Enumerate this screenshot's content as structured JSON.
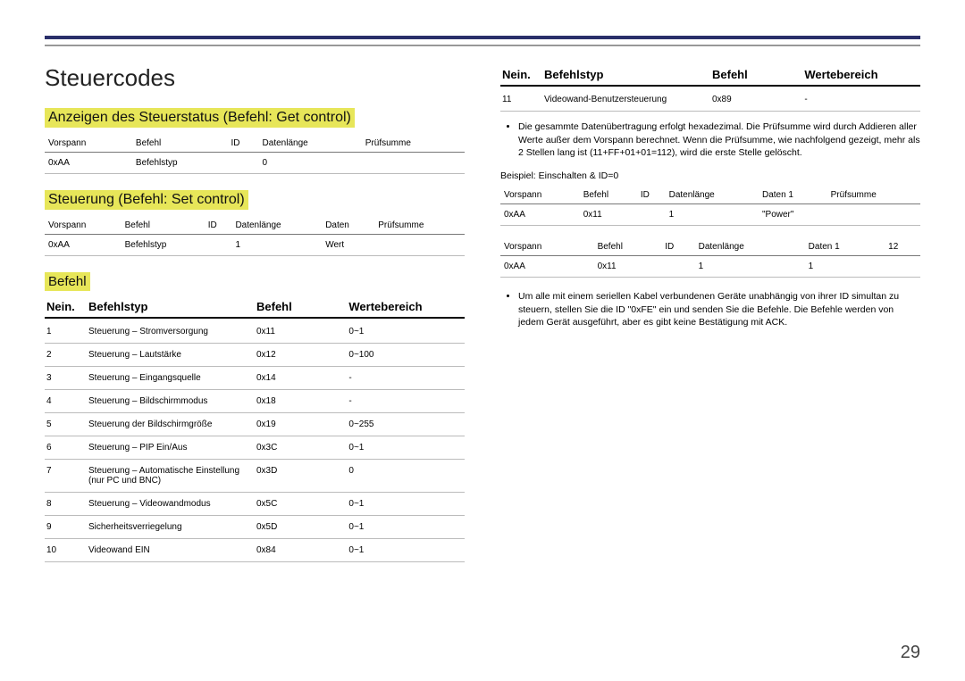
{
  "page_number": "29",
  "title": "Steuercodes",
  "sec1": {
    "heading": "Anzeigen des Steuerstatus (Befehl: Get control)",
    "headers": [
      "Vorspann",
      "Befehl",
      "ID",
      "Datenlänge",
      "Prüfsumme"
    ],
    "row": [
      "0xAA",
      "Befehlstyp",
      "",
      "0",
      ""
    ]
  },
  "sec2": {
    "heading": "Steuerung (Befehl: Set control)",
    "headers": [
      "Vorspann",
      "Befehl",
      "ID",
      "Datenlänge",
      "Daten",
      "Prüfsumme"
    ],
    "row": [
      "0xAA",
      "Befehlstyp",
      "",
      "1",
      "Wert",
      ""
    ]
  },
  "cmd": {
    "heading": "Befehl",
    "cols": [
      "Nein.",
      "Befehlstyp",
      "Befehl",
      "Wertebereich"
    ],
    "rows": [
      [
        "1",
        "Steuerung – Stromversorgung",
        "0x11",
        "0~1"
      ],
      [
        "2",
        "Steuerung – Lautstärke",
        "0x12",
        "0~100"
      ],
      [
        "3",
        "Steuerung – Eingangsquelle",
        "0x14",
        "-"
      ],
      [
        "4",
        "Steuerung – Bildschirmmodus",
        "0x18",
        "-"
      ],
      [
        "5",
        "Steuerung der Bildschirmgröße",
        "0x19",
        "0~255"
      ],
      [
        "6",
        "Steuerung – PIP Ein/Aus",
        "0x3C",
        "0~1"
      ],
      [
        "7",
        "Steuerung – Automatische Einstellung (nur PC und BNC)",
        "0x3D",
        "0"
      ],
      [
        "8",
        "Steuerung – Videowandmodus",
        "0x5C",
        "0~1"
      ],
      [
        "9",
        "Sicherheitsverriegelung",
        "0x5D",
        "0~1"
      ],
      [
        "10",
        "Videowand EIN",
        "0x84",
        "0~1"
      ]
    ]
  },
  "cmd2": {
    "cols": [
      "Nein.",
      "Befehlstyp",
      "Befehl",
      "Wertebereich"
    ],
    "rows": [
      [
        "11",
        "Videowand-Benutzersteuerung",
        "0x89",
        "-"
      ]
    ]
  },
  "note1": "Die gesammte Datenübertragung erfolgt hexadezimal. Die Prüfsumme wird durch Addieren aller Werte außer dem Vorspann berechnet. Wenn die Prüfsumme, wie nachfolgend gezeigt, mehr als 2 Stellen lang ist (11+FF+01+01=112), wird die erste Stelle gelöscht.",
  "example_label": "Beispiel: Einschalten & ID=0",
  "ex1": {
    "headers": [
      "Vorspann",
      "Befehl",
      "ID",
      "Datenlänge",
      "Daten 1",
      "Prüfsumme"
    ],
    "row": [
      "0xAA",
      "0x11",
      "",
      "1",
      "\"Power\"",
      ""
    ]
  },
  "ex2": {
    "headers": [
      "Vorspann",
      "Befehl",
      "ID",
      "Datenlänge",
      "Daten 1",
      "12"
    ],
    "row": [
      "0xAA",
      "0x11",
      "",
      "1",
      "1",
      ""
    ]
  },
  "note2": "Um alle mit einem seriellen Kabel verbundenen Geräte unabhängig von ihrer ID simultan zu steuern, stellen Sie die ID \"0xFE\" ein und senden Sie die Befehle. Die Befehle werden von jedem Gerät ausgeführt, aber es gibt keine Bestätigung mit ACK."
}
